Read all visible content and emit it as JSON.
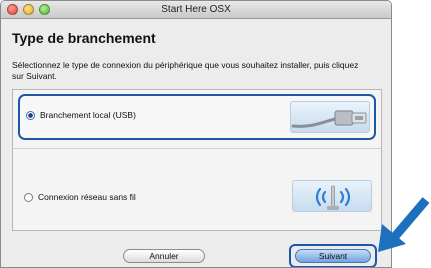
{
  "window": {
    "title": "Start Here OSX"
  },
  "page": {
    "heading": "Type de branchement",
    "instruction": "Sélectionnez le type de connexion du périphérique que vous souhaitez installer, puis cliquez sur Suivant."
  },
  "options": [
    {
      "label": "Branchement local (USB)",
      "selected": true,
      "icon": "usb-cable-icon"
    },
    {
      "label": "Connexion réseau sans fil",
      "selected": false,
      "icon": "wireless-signal-icon"
    }
  ],
  "buttons": {
    "cancel": "Annuler",
    "next": "Suivant"
  },
  "colors": {
    "highlight": "#1f57a8",
    "arrow": "#1f6fbf"
  }
}
